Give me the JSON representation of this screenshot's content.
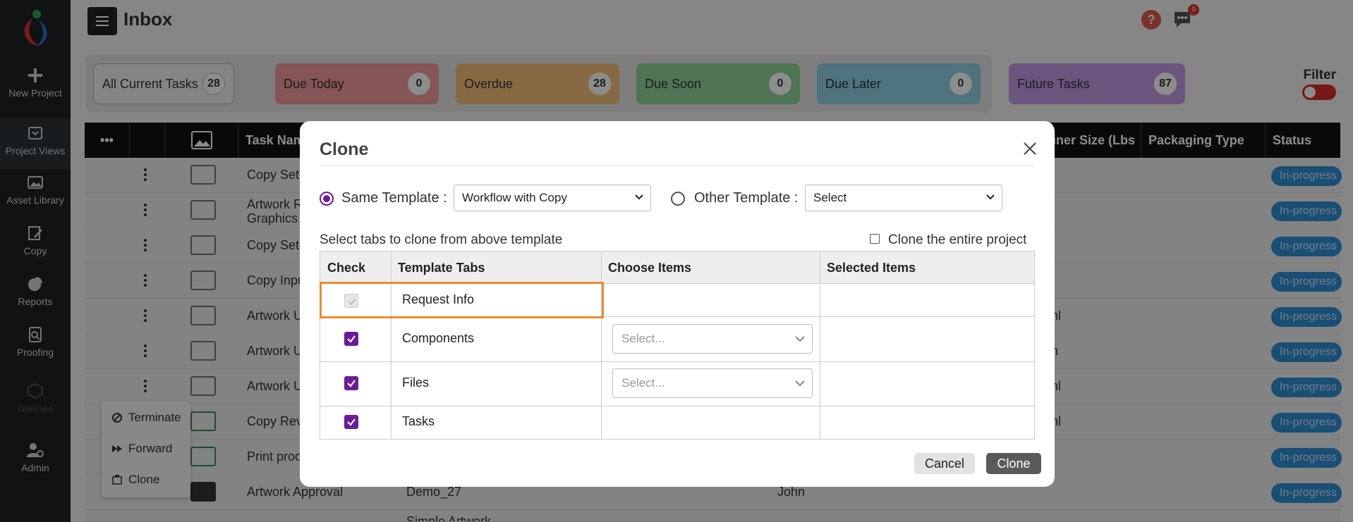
{
  "sidebar": {
    "items": [
      {
        "label": "New Project",
        "icon": "plus-icon"
      },
      {
        "label": "Project Views",
        "icon": "inbox-icon"
      },
      {
        "label": "Asset Library",
        "icon": "image-icon"
      },
      {
        "label": "Copy",
        "icon": "edit-icon"
      },
      {
        "label": "Reports",
        "icon": "pie-chart-icon"
      },
      {
        "label": "Proofing",
        "icon": "proofing-icon"
      },
      {
        "label": "Dielines",
        "icon": "cube-icon"
      },
      {
        "label": "Admin",
        "icon": "user-gear-icon"
      }
    ]
  },
  "header": {
    "title": "Inbox",
    "help": "?",
    "chat_badge": "0"
  },
  "tiles": [
    {
      "label": "All Current Tasks",
      "count": "28",
      "color": "#f2f2f2"
    },
    {
      "label": "Due Today",
      "count": "0",
      "color": "#f29a9a"
    },
    {
      "label": "Overdue",
      "count": "28",
      "color": "#f6c27a"
    },
    {
      "label": "Due Soon",
      "count": "0",
      "color": "#8fd49a"
    },
    {
      "label": "Due Later",
      "count": "0",
      "color": "#8fd0e6"
    },
    {
      "label": "Future Tasks",
      "count": "87",
      "color": "#c49be6"
    }
  ],
  "filter": {
    "label": "Filter"
  },
  "table": {
    "headers": [
      "•••",
      "",
      "",
      "Task Nam",
      "ainer Size (Lbs",
      "Packaging Type",
      "Status"
    ],
    "rows": [
      {
        "name": "Copy Set-",
        "status": "In-progress"
      },
      {
        "name": "Artwork R",
        "name2": "Graphics",
        "status": "In-progress"
      },
      {
        "name": "Copy Set-",
        "status": "In-progress"
      },
      {
        "name": "Copy Inpu",
        "status": "In-progress"
      },
      {
        "name": "Artwork U",
        "extra": "nl",
        "status": "In-progress"
      },
      {
        "name": "Artwork U",
        "extra": "n",
        "status": "In-progress"
      },
      {
        "name": "Artwork U",
        "extra": "nl",
        "status": "In-progress"
      },
      {
        "name": "Copy Rev",
        "extra": "nl",
        "status": "In-progress"
      },
      {
        "name": "Print proo",
        "status": "In-progress"
      },
      {
        "name": "Artwork Approval",
        "c2": "Demo_27",
        "c3": "John",
        "status": "In-progress"
      },
      {
        "name": "",
        "c2": "Simple Artwork",
        "status": ""
      }
    ]
  },
  "context_menu": {
    "items": [
      {
        "label": "Terminate"
      },
      {
        "label": "Forward"
      },
      {
        "label": "Clone"
      }
    ]
  },
  "modal": {
    "title": "Clone",
    "same_template_label": "Same Template :",
    "same_template_value": "Workflow with Copy",
    "other_template_label": "Other Template :",
    "other_template_value": "Select",
    "instruction": "Select tabs to clone from above template",
    "clone_entire_label": "Clone the entire project",
    "columns": [
      "Check",
      "Template Tabs",
      "Choose Items",
      "Selected Items"
    ],
    "rows": [
      {
        "tab": "Request Info",
        "checked": true,
        "disabled": true,
        "choose": ""
      },
      {
        "tab": "Components",
        "checked": true,
        "disabled": false,
        "choose": "Select..."
      },
      {
        "tab": "Files",
        "checked": true,
        "disabled": false,
        "choose": "Select..."
      },
      {
        "tab": "Tasks",
        "checked": true,
        "disabled": false,
        "choose": ""
      }
    ],
    "cancel_label": "Cancel",
    "clone_label": "Clone",
    "accent_color": "#6a1b9a",
    "highlight_color": "#f08a2c"
  }
}
